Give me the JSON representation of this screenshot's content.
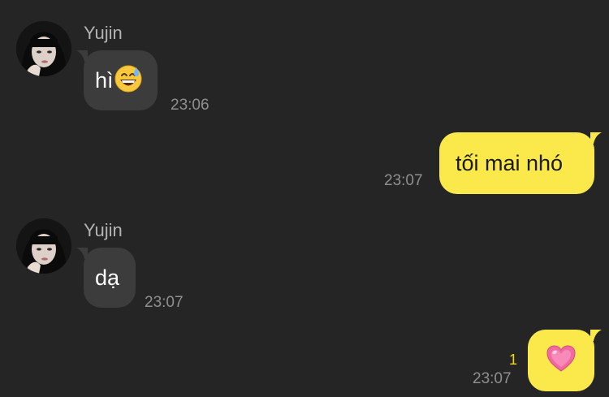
{
  "colors": {
    "background": "#252525",
    "incoming_bubble": "#3c3c3c",
    "outgoing_bubble": "#fbe94c",
    "timestamp": "#8f8f8f",
    "read_count": "#f5d800"
  },
  "messages": [
    {
      "direction": "incoming",
      "sender": "Yujin",
      "text": "hì",
      "emoji": "grinning-sweat-icon",
      "time": "23:06"
    },
    {
      "direction": "outgoing",
      "text": "tối mai nhó",
      "time": "23:07"
    },
    {
      "direction": "incoming",
      "sender": "Yujin",
      "text": "dạ",
      "time": "23:07"
    },
    {
      "direction": "outgoing",
      "emoji": "pink-heart-icon",
      "unread_count": "1",
      "time": "23:07"
    }
  ]
}
